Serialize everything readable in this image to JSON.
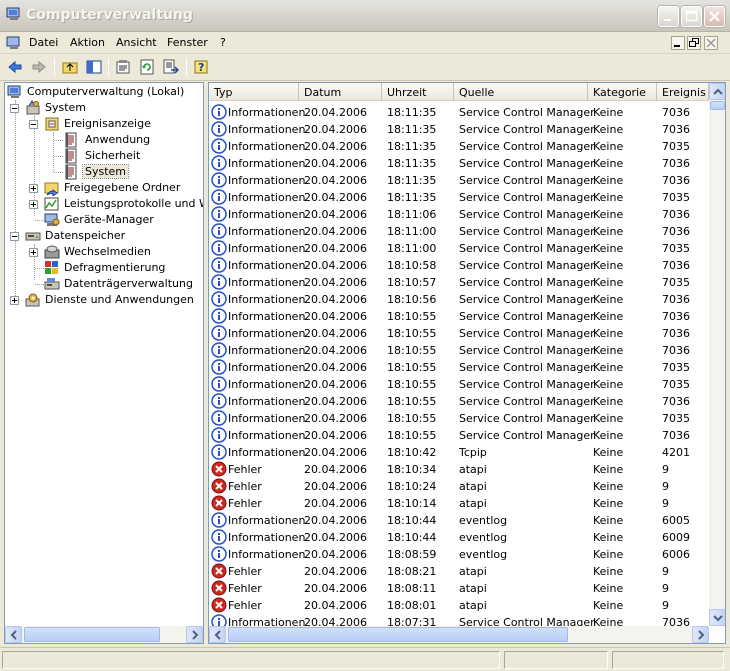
{
  "window": {
    "title": "Computerverwaltung",
    "colors": {
      "accent": "#316ac5",
      "error": "#cc2a1e",
      "info": "#2550c8"
    }
  },
  "menu": [
    "Datei",
    "Aktion",
    "Ansicht",
    "Fenster",
    "?"
  ],
  "toolbar": {
    "icons": [
      "back-arrow-icon",
      "forward-arrow-icon",
      "up-folder-icon",
      "show-tree-icon",
      "properties-icon",
      "refresh-icon",
      "export-list-icon",
      "help-icon"
    ]
  },
  "tree": {
    "nodes": [
      {
        "label": "Computerverwaltung (Lokal)",
        "icon": "computer-icon"
      },
      {
        "label": "System",
        "icon": "tools-icon"
      },
      {
        "label": "Ereignisanzeige",
        "icon": "event-viewer-icon"
      },
      {
        "label": "Anwendung",
        "icon": "log-icon"
      },
      {
        "label": "Sicherheit",
        "icon": "log-icon"
      },
      {
        "label": "System",
        "icon": "log-icon",
        "selected": true
      },
      {
        "label": "Freigegebene Ordner",
        "icon": "shared-folder-icon"
      },
      {
        "label": "Leistungsprotokolle und Warn",
        "icon": "performance-icon"
      },
      {
        "label": "Geräte-Manager",
        "icon": "device-manager-icon"
      },
      {
        "label": "Datenspeicher",
        "icon": "storage-icon"
      },
      {
        "label": "Wechselmedien",
        "icon": "removable-media-icon"
      },
      {
        "label": "Defragmentierung",
        "icon": "defrag-icon"
      },
      {
        "label": "Datenträgerverwaltung",
        "icon": "disk-management-icon"
      },
      {
        "label": "Dienste und Anwendungen",
        "icon": "services-icon"
      }
    ]
  },
  "list": {
    "columns": [
      "Typ",
      "Datum",
      "Uhrzeit",
      "Quelle",
      "Kategorie",
      "Ereignis"
    ],
    "rows": [
      {
        "type": "Informationen",
        "icon": "info-icon",
        "date": "20.04.2006",
        "time": "18:11:35",
        "source": "Service Control Manager",
        "category": "Keine",
        "event": "7036"
      },
      {
        "type": "Informationen",
        "icon": "info-icon",
        "date": "20.04.2006",
        "time": "18:11:35",
        "source": "Service Control Manager",
        "category": "Keine",
        "event": "7036"
      },
      {
        "type": "Informationen",
        "icon": "info-icon",
        "date": "20.04.2006",
        "time": "18:11:35",
        "source": "Service Control Manager",
        "category": "Keine",
        "event": "7035"
      },
      {
        "type": "Informationen",
        "icon": "info-icon",
        "date": "20.04.2006",
        "time": "18:11:35",
        "source": "Service Control Manager",
        "category": "Keine",
        "event": "7036"
      },
      {
        "type": "Informationen",
        "icon": "info-icon",
        "date": "20.04.2006",
        "time": "18:11:35",
        "source": "Service Control Manager",
        "category": "Keine",
        "event": "7036"
      },
      {
        "type": "Informationen",
        "icon": "info-icon",
        "date": "20.04.2006",
        "time": "18:11:35",
        "source": "Service Control Manager",
        "category": "Keine",
        "event": "7035"
      },
      {
        "type": "Informationen",
        "icon": "info-icon",
        "date": "20.04.2006",
        "time": "18:11:06",
        "source": "Service Control Manager",
        "category": "Keine",
        "event": "7036"
      },
      {
        "type": "Informationen",
        "icon": "info-icon",
        "date": "20.04.2006",
        "time": "18:11:00",
        "source": "Service Control Manager",
        "category": "Keine",
        "event": "7036"
      },
      {
        "type": "Informationen",
        "icon": "info-icon",
        "date": "20.04.2006",
        "time": "18:11:00",
        "source": "Service Control Manager",
        "category": "Keine",
        "event": "7035"
      },
      {
        "type": "Informationen",
        "icon": "info-icon",
        "date": "20.04.2006",
        "time": "18:10:58",
        "source": "Service Control Manager",
        "category": "Keine",
        "event": "7036"
      },
      {
        "type": "Informationen",
        "icon": "info-icon",
        "date": "20.04.2006",
        "time": "18:10:57",
        "source": "Service Control Manager",
        "category": "Keine",
        "event": "7035"
      },
      {
        "type": "Informationen",
        "icon": "info-icon",
        "date": "20.04.2006",
        "time": "18:10:56",
        "source": "Service Control Manager",
        "category": "Keine",
        "event": "7036"
      },
      {
        "type": "Informationen",
        "icon": "info-icon",
        "date": "20.04.2006",
        "time": "18:10:55",
        "source": "Service Control Manager",
        "category": "Keine",
        "event": "7036"
      },
      {
        "type": "Informationen",
        "icon": "info-icon",
        "date": "20.04.2006",
        "time": "18:10:55",
        "source": "Service Control Manager",
        "category": "Keine",
        "event": "7036"
      },
      {
        "type": "Informationen",
        "icon": "info-icon",
        "date": "20.04.2006",
        "time": "18:10:55",
        "source": "Service Control Manager",
        "category": "Keine",
        "event": "7036"
      },
      {
        "type": "Informationen",
        "icon": "info-icon",
        "date": "20.04.2006",
        "time": "18:10:55",
        "source": "Service Control Manager",
        "category": "Keine",
        "event": "7035"
      },
      {
        "type": "Informationen",
        "icon": "info-icon",
        "date": "20.04.2006",
        "time": "18:10:55",
        "source": "Service Control Manager",
        "category": "Keine",
        "event": "7035"
      },
      {
        "type": "Informationen",
        "icon": "info-icon",
        "date": "20.04.2006",
        "time": "18:10:55",
        "source": "Service Control Manager",
        "category": "Keine",
        "event": "7036"
      },
      {
        "type": "Informationen",
        "icon": "info-icon",
        "date": "20.04.2006",
        "time": "18:10:55",
        "source": "Service Control Manager",
        "category": "Keine",
        "event": "7035"
      },
      {
        "type": "Informationen",
        "icon": "info-icon",
        "date": "20.04.2006",
        "time": "18:10:55",
        "source": "Service Control Manager",
        "category": "Keine",
        "event": "7036"
      },
      {
        "type": "Informationen",
        "icon": "info-icon",
        "date": "20.04.2006",
        "time": "18:10:42",
        "source": "Tcpip",
        "category": "Keine",
        "event": "4201"
      },
      {
        "type": "Fehler",
        "icon": "error-icon",
        "date": "20.04.2006",
        "time": "18:10:34",
        "source": "atapi",
        "category": "Keine",
        "event": "9"
      },
      {
        "type": "Fehler",
        "icon": "error-icon",
        "date": "20.04.2006",
        "time": "18:10:24",
        "source": "atapi",
        "category": "Keine",
        "event": "9"
      },
      {
        "type": "Fehler",
        "icon": "error-icon",
        "date": "20.04.2006",
        "time": "18:10:14",
        "source": "atapi",
        "category": "Keine",
        "event": "9"
      },
      {
        "type": "Informationen",
        "icon": "info-icon",
        "date": "20.04.2006",
        "time": "18:10:44",
        "source": "eventlog",
        "category": "Keine",
        "event": "6005"
      },
      {
        "type": "Informationen",
        "icon": "info-icon",
        "date": "20.04.2006",
        "time": "18:10:44",
        "source": "eventlog",
        "category": "Keine",
        "event": "6009"
      },
      {
        "type": "Informationen",
        "icon": "info-icon",
        "date": "20.04.2006",
        "time": "18:08:59",
        "source": "eventlog",
        "category": "Keine",
        "event": "6006"
      },
      {
        "type": "Fehler",
        "icon": "error-icon",
        "date": "20.04.2006",
        "time": "18:08:21",
        "source": "atapi",
        "category": "Keine",
        "event": "9"
      },
      {
        "type": "Fehler",
        "icon": "error-icon",
        "date": "20.04.2006",
        "time": "18:08:11",
        "source": "atapi",
        "category": "Keine",
        "event": "9"
      },
      {
        "type": "Fehler",
        "icon": "error-icon",
        "date": "20.04.2006",
        "time": "18:08:01",
        "source": "atapi",
        "category": "Keine",
        "event": "9"
      },
      {
        "type": "Informationen",
        "icon": "info-icon",
        "date": "20.04.2006",
        "time": "18:07:31",
        "source": "Service Control Manager",
        "category": "Keine",
        "event": "7036"
      }
    ]
  }
}
